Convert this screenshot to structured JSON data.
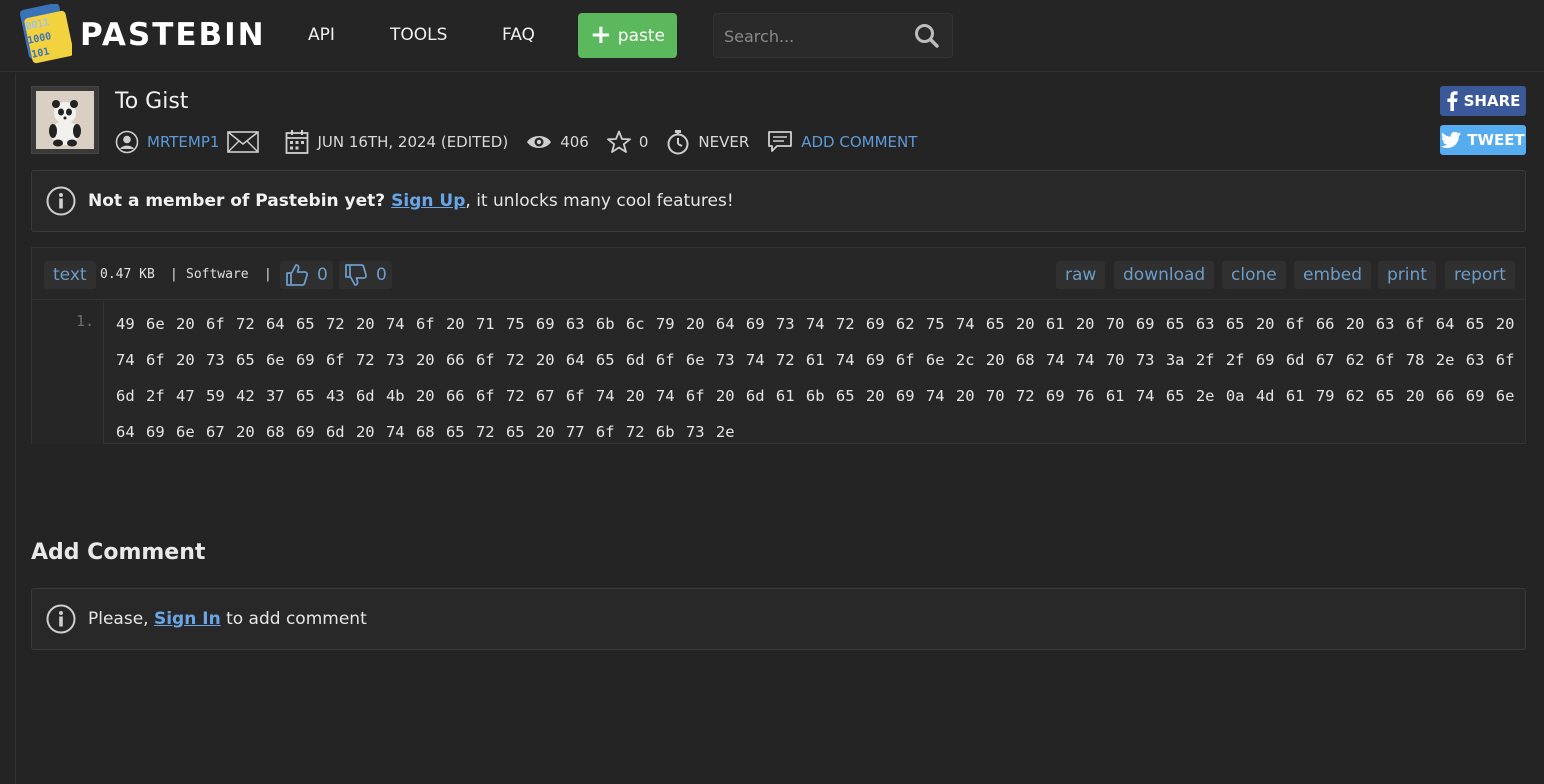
{
  "header": {
    "logo_text": "PASTEBIN",
    "logo_digits": [
      "0011",
      "1000",
      "101"
    ],
    "nav": [
      "API",
      "TOOLS",
      "FAQ"
    ],
    "paste_button": "paste",
    "search_placeholder": "Search..."
  },
  "paste": {
    "title": "To Gist",
    "author": "MRTEMP1",
    "date": "JUN 16TH, 2024 (EDITED)",
    "views": "406",
    "stars": "0",
    "expiry": "NEVER",
    "add_comment": "ADD COMMENT"
  },
  "social": {
    "share": "SHARE",
    "tweet": "TWEET"
  },
  "notice": {
    "bold": "Not a member of Pastebin yet?",
    "link": "Sign Up",
    "rest": ", it unlocks many cool features!"
  },
  "code": {
    "syntax": "text",
    "size": "0.47 KB",
    "sep1": "|",
    "category": "Software",
    "sep2": "|",
    "likes": "0",
    "dislikes": "0",
    "actions": [
      "raw",
      "download",
      "clone",
      "embed",
      "print",
      "report"
    ],
    "line_number": "1.",
    "content": "49 6e 20 6f 72 64 65 72 20 74 6f 20 71 75 69 63 6b 6c 79 20 64 69 73 74 72 69 62 75 74 65 20 61 20 70 69 65 63 65 20 6f 66 20 63 6f 64 65 20 74 6f 20 73 65 6e 69 6f 72 73 20 66 6f 72 20 64 65 6d 6f 6e 73 74 72 61 74 69 6f 6e 2c 20 68 74 74 70 73 3a 2f 2f 69 6d 67 62 6f 78 2e 63 6f 6d 2f 47 59 42 37 65 43 6d 4b 20 66 6f 72 67 6f 74 20 74 6f 20 6d 61 6b 65 20 69 74 20 70 72 69 76 61 74 65 2e 0a 4d 61 79 62 65 20 66 69 6e 64 69 6e 67 20 68 69 6d 20 74 68 65 72 65 20 77 6f 72 6b 73 2e"
  },
  "comments": {
    "title": "Add Comment",
    "prefix": "Please, ",
    "link": "Sign In",
    "suffix": " to add comment"
  },
  "colors": {
    "accent_green": "#5cb85c",
    "link_blue": "#5d9ad8",
    "facebook": "#3b5998",
    "twitter": "#55acee"
  }
}
